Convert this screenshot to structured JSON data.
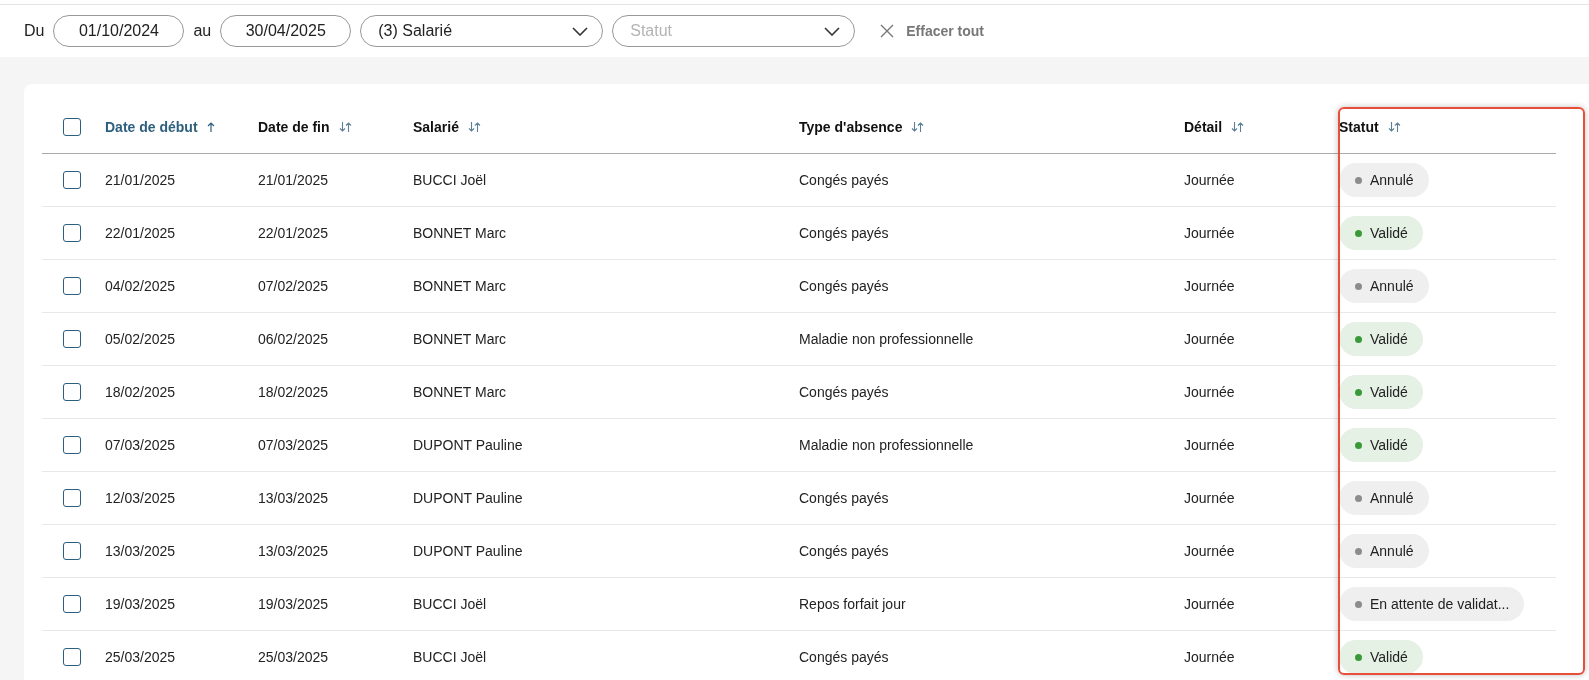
{
  "filters": {
    "from_label": "Du",
    "from_value": "01/10/2024",
    "to_label": "au",
    "to_value": "30/04/2025",
    "employee_select": {
      "value": "(3) Salarié"
    },
    "status_select": {
      "placeholder": "Statut"
    },
    "clear_label": "Effacer tout"
  },
  "table": {
    "select_all": {
      "checked": false
    },
    "columns": [
      {
        "label": "Date de début",
        "sorted": true
      },
      {
        "label": "Date de fin",
        "sorted": false
      },
      {
        "label": "Salarié",
        "sorted": false
      },
      {
        "label": "Type d'absence",
        "sorted": false
      },
      {
        "label": "Détail",
        "sorted": false
      },
      {
        "label": "Statut",
        "sorted": false,
        "highlighted": true
      }
    ],
    "rows": [
      {
        "checked": false,
        "start": "21/01/2025",
        "end": "21/01/2025",
        "employee": "BUCCI Joël",
        "type": "Congés payés",
        "detail": "Journée",
        "status": {
          "label": "Annulé",
          "kind": "neutral",
          "color": "#8c8c8c"
        }
      },
      {
        "checked": false,
        "start": "22/01/2025",
        "end": "22/01/2025",
        "employee": "BONNET Marc",
        "type": "Congés payés",
        "detail": "Journée",
        "status": {
          "label": "Validé",
          "kind": "success",
          "color": "#3a9a3a"
        }
      },
      {
        "checked": false,
        "start": "04/02/2025",
        "end": "07/02/2025",
        "employee": "BONNET Marc",
        "type": "Congés payés",
        "detail": "Journée",
        "status": {
          "label": "Annulé",
          "kind": "neutral",
          "color": "#8c8c8c"
        }
      },
      {
        "checked": false,
        "start": "05/02/2025",
        "end": "06/02/2025",
        "employee": "BONNET Marc",
        "type": "Maladie non professionnelle",
        "detail": "Journée",
        "status": {
          "label": "Validé",
          "kind": "success",
          "color": "#3a9a3a"
        }
      },
      {
        "checked": false,
        "start": "18/02/2025",
        "end": "18/02/2025",
        "employee": "BONNET Marc",
        "type": "Congés payés",
        "detail": "Journée",
        "status": {
          "label": "Validé",
          "kind": "success",
          "color": "#3a9a3a"
        }
      },
      {
        "checked": false,
        "start": "07/03/2025",
        "end": "07/03/2025",
        "employee": "DUPONT Pauline",
        "type": "Maladie non professionnelle",
        "detail": "Journée",
        "status": {
          "label": "Validé",
          "kind": "success",
          "color": "#3a9a3a"
        }
      },
      {
        "checked": false,
        "start": "12/03/2025",
        "end": "13/03/2025",
        "employee": "DUPONT Pauline",
        "type": "Congés payés",
        "detail": "Journée",
        "status": {
          "label": "Annulé",
          "kind": "neutral",
          "color": "#8c8c8c"
        }
      },
      {
        "checked": false,
        "start": "13/03/2025",
        "end": "13/03/2025",
        "employee": "DUPONT Pauline",
        "type": "Congés payés",
        "detail": "Journée",
        "status": {
          "label": "Annulé",
          "kind": "neutral",
          "color": "#8c8c8c"
        }
      },
      {
        "checked": false,
        "start": "19/03/2025",
        "end": "19/03/2025",
        "employee": "BUCCI Joël",
        "type": "Repos forfait jour",
        "detail": "Journée",
        "status": {
          "label": "En attente de validat...",
          "kind": "neutral",
          "color": "#8c8c8c"
        }
      },
      {
        "checked": false,
        "start": "25/03/2025",
        "end": "25/03/2025",
        "employee": "BUCCI Joël",
        "type": "Congés payés",
        "detail": "Journée",
        "status": {
          "label": "Validé",
          "kind": "success",
          "color": "#3a9a3a"
        }
      }
    ]
  }
}
